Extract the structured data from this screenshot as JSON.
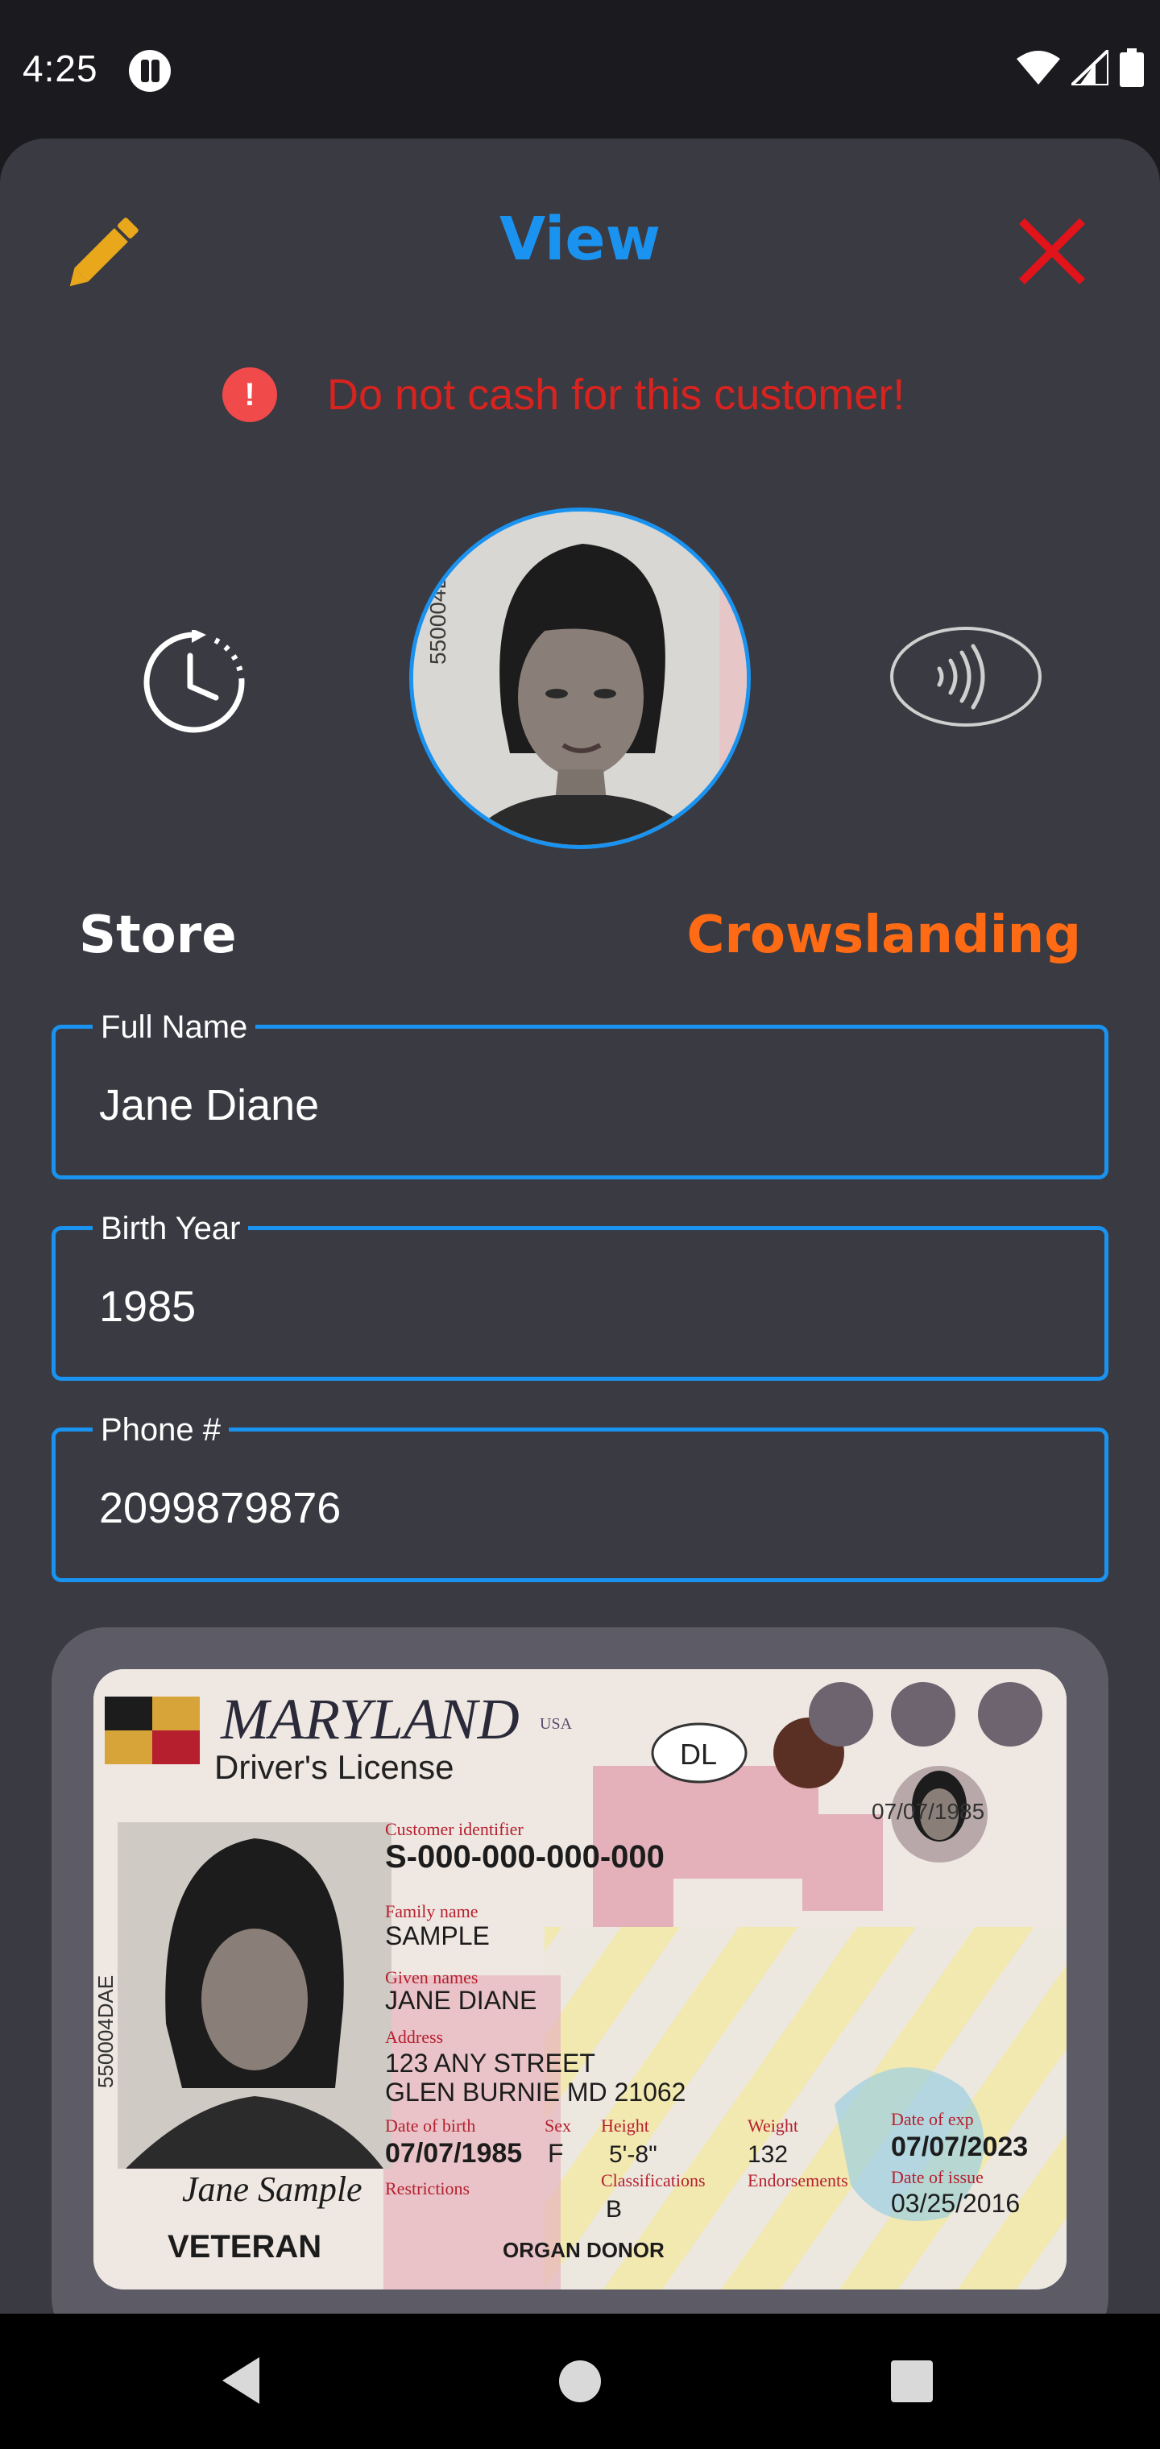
{
  "status_bar": {
    "time": "4:25"
  },
  "header": {
    "title": "View"
  },
  "alert": {
    "message": "Do not cash for this customer!",
    "icon_glyph": "!"
  },
  "store": {
    "label": "Store",
    "value": "Crowslanding"
  },
  "fields": {
    "full_name": {
      "label": "Full Name",
      "value": "Jane Diane"
    },
    "birth_year": {
      "label": "Birth Year",
      "value": "1985"
    },
    "phone": {
      "label": "Phone #",
      "value": "2099879876"
    }
  },
  "id_card": {
    "state": "MARYLAND",
    "state_abbr": "USA",
    "doc_type": "Driver's License",
    "class_badge": "DL",
    "side_number": "550004DAE",
    "mini_dob": "07/07/1985",
    "customer_id_label": "Customer identifier",
    "customer_id": "S-000-000-000-000",
    "family_name_label": "Family name",
    "family_name": "SAMPLE",
    "given_names_label": "Given names",
    "given_names": "JANE DIANE",
    "address_label": "Address",
    "address_line1": "123 ANY STREET",
    "address_line2": "GLEN BURNIE MD 21062",
    "dob_label": "Date of birth",
    "dob": "07/07/1985",
    "sex_label": "Sex",
    "sex": "F",
    "height_label": "Height",
    "height": "5'-8\"",
    "weight_label": "Weight",
    "weight": "132",
    "exp_label": "Date of exp",
    "exp": "07/07/2023",
    "restrictions_label": "Restrictions",
    "classifications_label": "Classifications",
    "classification": "B",
    "endorsements_label": "Endorsements",
    "issue_label": "Date of issue",
    "issue": "03/25/2016",
    "veteran": "VETERAN",
    "organ_donor": "ORGAN DONOR",
    "signature": "Jane Sample"
  },
  "colors": {
    "accent_blue": "#1a93f0",
    "alert_red": "#d9231f",
    "store_orange": "#ff6a14",
    "sheet_bg": "#3a3a42"
  },
  "icons": [
    "edit-pencil-icon",
    "close-icon",
    "alert-icon",
    "history-clock-icon",
    "nfc-contactless-icon",
    "wifi-icon",
    "signal-icon",
    "battery-icon",
    "nav-back-icon",
    "nav-home-icon",
    "nav-recents-icon"
  ]
}
